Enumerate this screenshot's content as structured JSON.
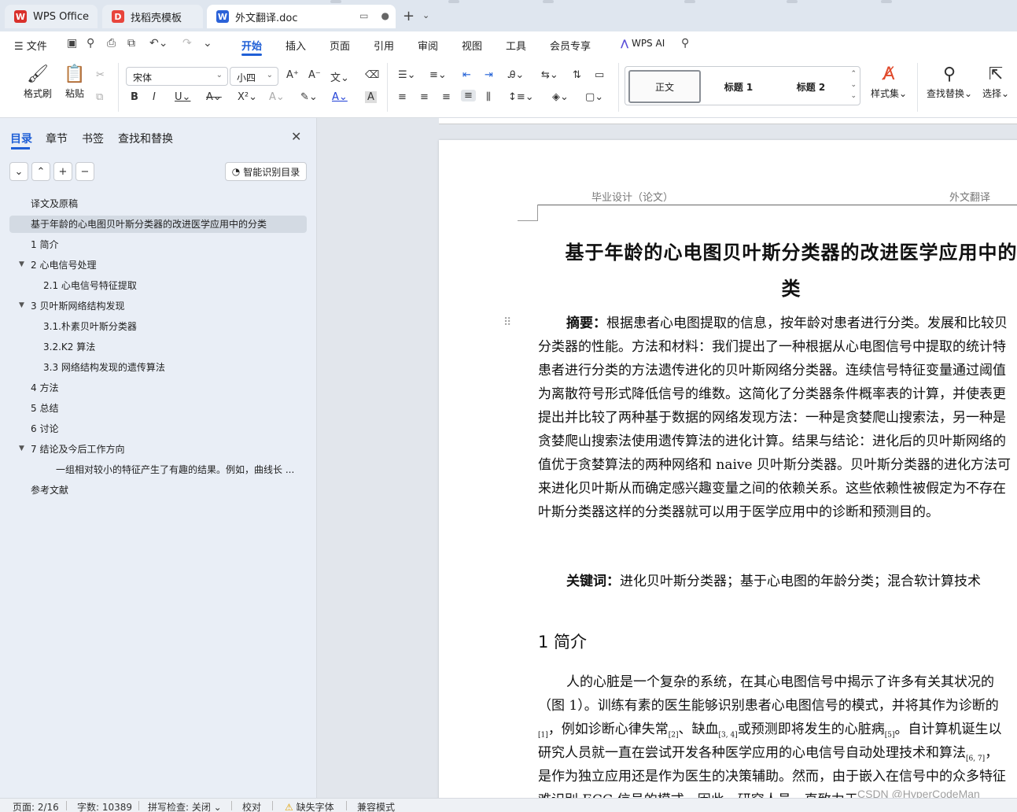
{
  "tabs": [
    {
      "label": "WPS Office",
      "logo": "W",
      "logo_color": "#d9302b",
      "state": "inactive"
    },
    {
      "label": "找稻壳模板",
      "logo": "D",
      "logo_color": "#e8453c",
      "state": "inactive"
    },
    {
      "label": "外文翻译.doc",
      "logo": "W",
      "logo_color": "#2b62d8",
      "state": "active"
    }
  ],
  "tab_icons": {
    "new_tab": "+",
    "new_tab_menu": "⌄",
    "tab_close_dot": "●",
    "tab_monitor": "▭"
  },
  "menu": {
    "file": "文件",
    "items": [
      "开始",
      "插入",
      "页面",
      "引用",
      "审阅",
      "视图",
      "工具",
      "会员专享"
    ],
    "active_index": 0,
    "wps_ai": "WPS AI"
  },
  "ribbon": {
    "format_painter": "格式刷",
    "paste": "粘贴",
    "font_name": "宋体",
    "font_size": "小四",
    "styles": [
      "正文",
      "标题 1",
      "标题 2"
    ],
    "styles_set": "样式集",
    "find_replace": "查找替换",
    "select": "选择"
  },
  "nav": {
    "tabs": [
      "目录",
      "章节",
      "书签",
      "查找和替换"
    ],
    "active_tab": 0,
    "smart_toc": "智能识别目录",
    "toc": [
      {
        "text": "译文及原稿",
        "level": 0,
        "arrow": ""
      },
      {
        "text": "基于年龄的心电图贝叶斯分类器的改进医学应用中的分类",
        "level": 0,
        "arrow": "",
        "selected": true
      },
      {
        "text": "1 简介",
        "level": 0,
        "arrow": ""
      },
      {
        "text": "2 心电信号处理",
        "level": 0,
        "arrow": "▼"
      },
      {
        "text": "2.1 心电信号特征提取",
        "level": 1,
        "arrow": ""
      },
      {
        "text": "3 贝叶斯网络结构发现",
        "level": 0,
        "arrow": "▼"
      },
      {
        "text": "3.1.朴素贝叶斯分类器",
        "level": 1,
        "arrow": ""
      },
      {
        "text": "3.2.K2 算法",
        "level": 1,
        "arrow": ""
      },
      {
        "text": "3.3 网络结构发现的遗传算法",
        "level": 1,
        "arrow": ""
      },
      {
        "text": "4 方法",
        "level": 0,
        "arrow": ""
      },
      {
        "text": "5 总结",
        "level": 0,
        "arrow": ""
      },
      {
        "text": "6 讨论",
        "level": 0,
        "arrow": ""
      },
      {
        "text": "7 结论及今后工作方向",
        "level": 0,
        "arrow": "▼"
      },
      {
        "text": "一组相对较小的特征产生了有趣的结果。例如，曲线长 ...",
        "level": 2,
        "arrow": ""
      },
      {
        "text": "参考文献",
        "level": 0,
        "arrow": ""
      }
    ]
  },
  "document": {
    "header_left": "毕业设计（论文）",
    "header_right": "外文翻译",
    "title_line1": "基于年龄的心电图贝叶斯分类器的改进医学应用中的",
    "title_line2": "类",
    "abstract_label": "摘要：",
    "abstract_lines": [
      "根据患者心电图提取的信息，按年龄对患者进行分类。发展和比较贝",
      "分类器的性能。方法和材料：我们提出了一种根据从心电图信号中提取的统计特",
      "患者进行分类的方法遗传进化的贝叶斯网络分类器。连续信号特征变量通过阈值",
      "为离散符号形式降低信号的维数。这简化了分类器条件概率表的计算，并使表更",
      "提出并比较了两种基于数据的网络发现方法：一种是贪婪爬山搜索法，另一种是",
      "贪婪爬山搜索法使用遗传算法的进化计算。结果与结论：进化后的贝叶斯网络的",
      "值优于贪婪算法的两种网络和 naive 贝叶斯分类器。贝叶斯分类器的进化方法可",
      "来进化贝叶斯从而确定感兴趣变量之间的依赖关系。这些依赖性被假定为不存在",
      "叶斯分类器这样的分类器就可以用于医学应用中的诊断和预测目的。"
    ],
    "keywords_label": "关键词：",
    "keywords": "进化贝叶斯分类器；基于心电图的年龄分类；混合软计算技术",
    "section1": "1  简介",
    "intro_lines": [
      "人的心脏是一个复杂的系统，在其心电图信号中揭示了许多有关其状况的",
      "（图 1）。训练有素的医生能够识别患者心电图信号的模式，并将其作为诊断的",
      "，例如诊断心律失常、缺血或预测即将发生的心脏病。自计算机诞生以",
      "研究人员就一直在尝试开发各种医学应用的心电信号自动处理技术和算法，",
      "是作为独立应用还是作为医生的决策辅助。然而，由于嵌入在信号中的众多特征",
      "难识别 ECG 信号的模式。因此，研究人员一直致力于"
    ],
    "citations": {
      "c1": "[1]",
      "c2": "[2]",
      "c34": "[3, 4]",
      "c5": "[5]",
      "c67": "[6, 7]"
    },
    "watermark": "CSDN @HyperCodeMan"
  },
  "status": {
    "page": "页面: 2/16",
    "words": "字数: 10389",
    "spell": "拼写检查: 关闭",
    "proof": "校对",
    "missing_font": "缺失字体",
    "compat": "兼容模式"
  }
}
